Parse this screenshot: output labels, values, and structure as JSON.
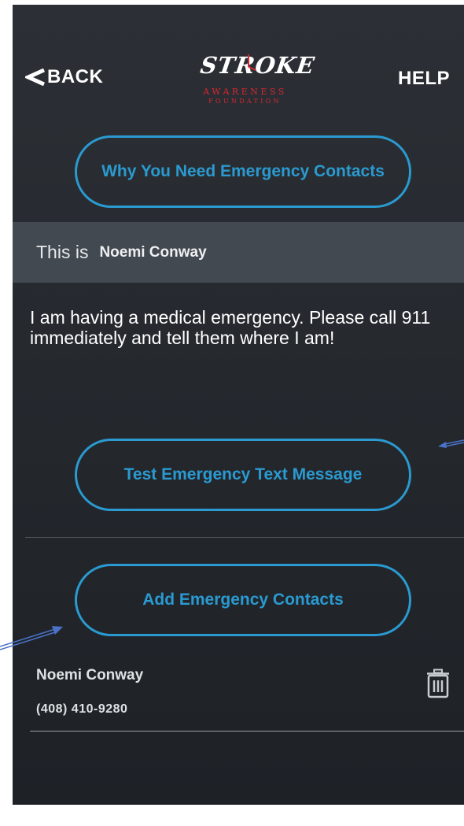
{
  "header": {
    "back_label": "BACK",
    "help_label": "HELP",
    "logo": {
      "word": "STROKE",
      "line1": "AWARENESS",
      "line2": "FOUNDATION"
    }
  },
  "buttons": {
    "why_label": "Why You Need Emergency Contacts",
    "test_label": "Test Emergency Text Message",
    "add_label": "Add Emergency Contacts"
  },
  "banner": {
    "prefix": "This is",
    "name": "Noemi Conway"
  },
  "message": "I am having a medical emergency. Please call 911 immediately and tell them where I am!",
  "contacts": [
    {
      "name": "Noemi Conway",
      "phone": "(408) 410-9280"
    }
  ],
  "colors": {
    "accent": "#2a9ad0",
    "logo_red": "#d6262f",
    "background": "#2a2e33",
    "banner": "#434950",
    "annotation_arrow": "#4a72c8"
  },
  "icons": [
    "chevron-left-icon",
    "clock-icon",
    "trash-icon",
    "annotation-arrow"
  ]
}
